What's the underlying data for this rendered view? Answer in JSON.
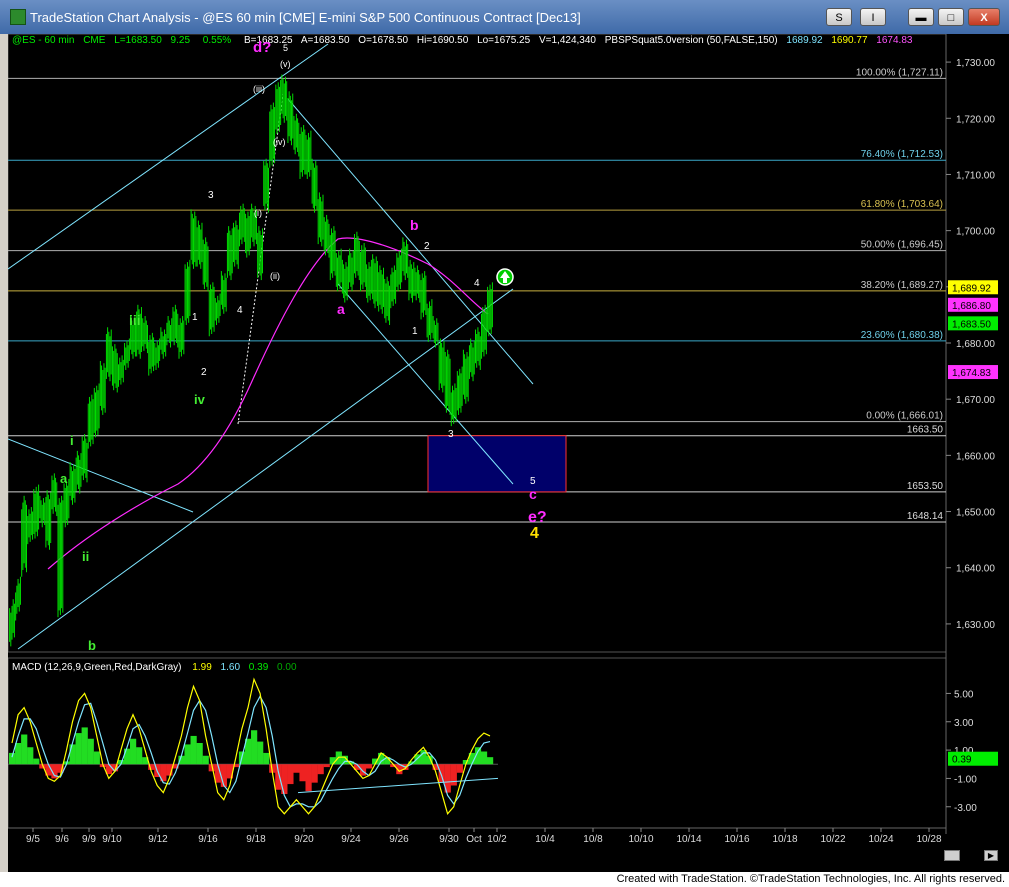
{
  "window": {
    "title": "TradeStation Chart Analysis - @ES 60 min [CME] E-mini S&P 500 Continuous Contract [Dec13]",
    "buttons": {
      "s": "S",
      "i": "I",
      "min": "",
      "max": "",
      "close": "X"
    }
  },
  "header": {
    "symbol": "@ES - 60 min",
    "exchange": "CME",
    "last": "L=1683.50",
    "change": "9.25",
    "pct": "0.55%",
    "bid": "B=1683.25",
    "ask": "A=1683.50",
    "open": "O=1678.50",
    "high": "Hi=1690.50",
    "low": "Lo=1675.25",
    "volume": "V=1,424,340",
    "indicator": "PBSPSquat5.0version (50,FALSE,150)",
    "ind_v1": "1689.92",
    "ind_v2": "1690.77",
    "ind_v3": "1674.83"
  },
  "macd_header": {
    "label": "MACD (12,26,9,Green,Red,DarkGray)",
    "v1": "1.99",
    "v2": "1.60",
    "v3": "0.39",
    "v4": "0.00"
  },
  "footer": {
    "text": "Created with TradeStation. ©TradeStation Technologies, Inc. All rights reserved."
  },
  "colors": {
    "bars": "#00dd00",
    "cyan": "#7fe5ff",
    "magenta": "#ff2bff",
    "yellow": "#ffe000",
    "green_label": "#44ee33"
  },
  "chart_data": {
    "type": "bar",
    "title": "",
    "xlabel": "",
    "ylabel": "",
    "ylim": [
      1625,
      1735
    ],
    "price_axis_ticks": [
      "1,730.00",
      "1,720.00",
      "1,710.00",
      "1,700.00",
      "1,690.00",
      "1,680.00",
      "1,670.00",
      "1,660.00",
      "1,650.00",
      "1,640.00",
      "1,630.00"
    ],
    "date_ticks": [
      "9/5",
      "9/6",
      "9/9",
      "9/10",
      "9/12",
      "9/16",
      "9/18",
      "9/20",
      "9/24",
      "9/26",
      "9/30",
      "Oct",
      "10/2",
      "10/4",
      "10/8",
      "10/10",
      "10/14",
      "10/16",
      "10/18",
      "10/22",
      "10/24",
      "10/28"
    ],
    "price_path": [
      [
        1634,
        1628
      ],
      [
        1638,
        1633
      ],
      [
        1652,
        1640
      ],
      [
        1650,
        1645
      ],
      [
        1654,
        1646
      ],
      [
        1652,
        1648
      ],
      [
        1653,
        1644
      ],
      [
        1656,
        1650
      ],
      [
        1652,
        1632
      ],
      [
        1655,
        1648
      ],
      [
        1658,
        1652
      ],
      [
        1660,
        1654
      ],
      [
        1663,
        1656
      ],
      [
        1670,
        1662
      ],
      [
        1672,
        1664
      ],
      [
        1676,
        1668
      ],
      [
        1682,
        1674
      ],
      [
        1679,
        1672
      ],
      [
        1677,
        1673
      ],
      [
        1680,
        1676
      ],
      [
        1684,
        1678
      ],
      [
        1686,
        1678
      ],
      [
        1684,
        1679
      ],
      [
        1681,
        1675
      ],
      [
        1680,
        1676
      ],
      [
        1682,
        1678
      ],
      [
        1684,
        1680
      ],
      [
        1686,
        1680
      ],
      [
        1684,
        1678
      ],
      [
        1694,
        1684
      ],
      [
        1703,
        1694
      ],
      [
        1701,
        1694
      ],
      [
        1698,
        1690
      ],
      [
        1690,
        1682
      ],
      [
        1688,
        1684
      ],
      [
        1692,
        1686
      ],
      [
        1700,
        1692
      ],
      [
        1701,
        1694
      ],
      [
        1704,
        1698
      ],
      [
        1703,
        1696
      ],
      [
        1704,
        1698
      ],
      [
        1700,
        1692
      ],
      [
        1712,
        1704
      ],
      [
        1722,
        1712
      ],
      [
        1726,
        1718
      ],
      [
        1727,
        1720
      ],
      [
        1724,
        1716
      ],
      [
        1720,
        1714
      ],
      [
        1718,
        1710
      ],
      [
        1717,
        1710
      ],
      [
        1712,
        1704
      ],
      [
        1706,
        1698
      ],
      [
        1702,
        1696
      ],
      [
        1700,
        1692
      ],
      [
        1696,
        1690
      ],
      [
        1694,
        1688
      ],
      [
        1696,
        1690
      ],
      [
        1699,
        1692
      ],
      [
        1697,
        1690
      ],
      [
        1694,
        1688
      ],
      [
        1695,
        1687
      ],
      [
        1693,
        1686
      ],
      [
        1691,
        1684
      ],
      [
        1693,
        1687
      ],
      [
        1696,
        1690
      ],
      [
        1698,
        1692
      ],
      [
        1694,
        1688
      ],
      [
        1693,
        1688
      ],
      [
        1692,
        1685
      ],
      [
        1687,
        1681
      ],
      [
        1684,
        1680
      ],
      [
        1680,
        1672
      ],
      [
        1678,
        1668
      ],
      [
        1672,
        1666
      ],
      [
        1675,
        1668
      ],
      [
        1678,
        1670
      ],
      [
        1680,
        1674
      ],
      [
        1682,
        1676
      ],
      [
        1686,
        1678
      ],
      [
        1690,
        1682
      ]
    ],
    "wave_labels": [
      "a",
      "b",
      "i",
      "ii",
      "iii",
      "iv",
      "1",
      "2",
      "3",
      "4",
      "d?",
      "5",
      "(i)",
      "(ii)",
      "(iii)",
      "(iv)",
      "(v)",
      "a",
      "b",
      "1",
      "2",
      "3",
      "4",
      "5",
      "c",
      "e?",
      "4"
    ],
    "fib_levels": [
      {
        "label": "100.00% (1,727.11)",
        "value": 1727.11
      },
      {
        "label": "76.40% (1,712.53)",
        "value": 1712.53
      },
      {
        "label": "61.80% (1,703.64)",
        "value": 1703.64
      },
      {
        "label": "50.00% (1,696.45)",
        "value": 1696.45
      },
      {
        "label": "38.20% (1,689.27)",
        "value": 1689.27
      },
      {
        "label": "23.60% (1,680.38)",
        "value": 1680.38
      },
      {
        "label": "0.00% (1,666.01)",
        "value": 1666.01
      }
    ],
    "horizontal_levels": [
      {
        "label": "1663.50",
        "value": 1663.5
      },
      {
        "label": "1653.50",
        "value": 1653.5
      },
      {
        "label": "1648.14",
        "value": 1648.14
      }
    ],
    "price_tags": [
      {
        "label": "1,689.92",
        "value": 1689.92,
        "color": "#ffff00"
      },
      {
        "label": "1,686.80",
        "value": 1686.8,
        "color": "#ff33ff"
      },
      {
        "label": "1,683.50",
        "value": 1683.5,
        "color": "#00ee00"
      },
      {
        "label": "1,674.83",
        "value": 1674.83,
        "color": "#ff33ff"
      }
    ],
    "target_box": {
      "from": 1663.5,
      "to": 1653.5
    },
    "macd": {
      "ylim": [
        -4.5,
        7.5
      ],
      "ticks": [
        "5.00",
        "3.00",
        "1.00",
        "-1.00",
        "-3.00"
      ],
      "last_value": "0.39",
      "histogram": [
        0.8,
        1.5,
        2.1,
        1.2,
        0.4,
        -0.3,
        -0.8,
        -1.0,
        -0.6,
        0.2,
        1.4,
        2.2,
        2.6,
        1.8,
        0.9,
        -0.2,
        -0.7,
        -0.5,
        0.3,
        1.1,
        1.8,
        1.2,
        0.5,
        -0.4,
        -0.9,
        -1.2,
        -0.8,
        -0.3,
        0.6,
        1.4,
        2.0,
        1.5,
        0.6,
        -0.5,
        -1.3,
        -1.6,
        -1.0,
        -0.2,
        0.9,
        1.8,
        2.4,
        1.6,
        0.8,
        -0.6,
        -1.8,
        -2.1,
        -1.4,
        -0.6,
        -1.2,
        -1.9,
        -1.3,
        -0.7,
        -0.2,
        0.5,
        0.9,
        0.6,
        0.2,
        -0.4,
        -0.8,
        -0.3,
        0.4,
        0.8,
        0.5,
        -0.2,
        -0.7,
        -0.4,
        0.2,
        0.7,
        1.0,
        0.6,
        -0.4,
        -1.3,
        -2.0,
        -1.5,
        -0.6,
        0.3,
        0.8,
        1.2,
        0.9,
        0.5
      ],
      "macd_line": [
        1.5,
        3.5,
        4.0,
        3.0,
        1.5,
        0.0,
        -1.0,
        -1.2,
        -0.8,
        1.0,
        3.0,
        4.5,
        5.0,
        4.0,
        2.0,
        0.0,
        -1.0,
        -0.5,
        1.0,
        2.5,
        3.5,
        2.5,
        1.0,
        -0.5,
        -1.5,
        -2.0,
        -1.0,
        0.5,
        2.0,
        4.0,
        5.5,
        4.5,
        2.0,
        0.0,
        -2.0,
        -2.5,
        -1.5,
        0.5,
        2.5,
        4.0,
        6.0,
        5.0,
        2.5,
        -0.5,
        -3.0,
        -3.5,
        -3.0,
        -2.5,
        -3.0,
        -3.5,
        -3.0,
        -2.0,
        -1.0,
        0.0,
        0.5,
        0.5,
        0.0,
        -0.5,
        -1.0,
        -0.8,
        0.0,
        0.8,
        0.5,
        0.0,
        -0.5,
        -0.3,
        0.3,
        0.8,
        1.2,
        0.5,
        -0.5,
        -2.0,
        -3.5,
        -3.0,
        -1.5,
        0.0,
        1.0,
        1.8,
        2.2,
        2.0
      ],
      "signal_line": [
        0.5,
        2.0,
        3.2,
        3.2,
        2.5,
        1.2,
        0.0,
        -0.8,
        -0.9,
        0.0,
        1.5,
        3.0,
        4.2,
        4.3,
        3.0,
        1.5,
        0.0,
        -0.5,
        0.0,
        1.2,
        2.5,
        2.8,
        2.0,
        0.8,
        -0.5,
        -1.3,
        -1.4,
        -0.6,
        0.6,
        2.2,
        3.8,
        4.5,
        3.8,
        2.0,
        0.0,
        -1.5,
        -2.0,
        -1.2,
        0.5,
        2.2,
        4.0,
        4.8,
        4.0,
        2.0,
        -0.5,
        -2.2,
        -3.0,
        -2.8,
        -2.8,
        -3.0,
        -3.0,
        -2.6,
        -1.8,
        -1.0,
        -0.3,
        0.2,
        0.2,
        0.0,
        -0.5,
        -0.8,
        -0.5,
        0.2,
        0.5,
        0.3,
        0.0,
        -0.2,
        0.0,
        0.4,
        0.8,
        0.8,
        0.3,
        -0.8,
        -2.2,
        -2.8,
        -2.2,
        -1.0,
        0.0,
        0.9,
        1.5,
        1.6
      ]
    }
  }
}
